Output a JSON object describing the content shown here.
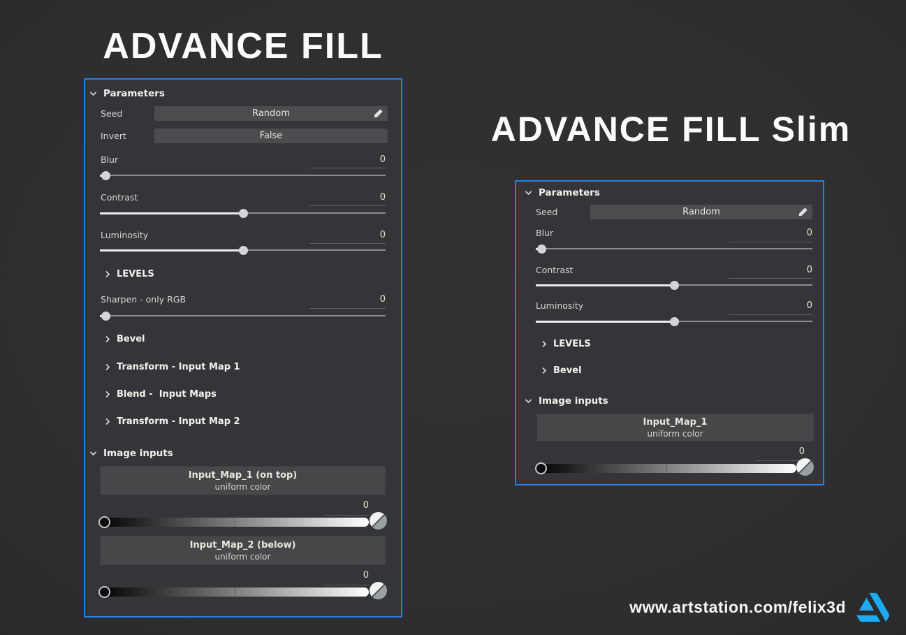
{
  "colors": {
    "accent_border": "#2b7de2",
    "artstation_blue": "#1caaf2",
    "panel_bg": "#333538",
    "button_bg": "#4a4c4e",
    "gradient_start": "#000000",
    "gradient_end": "#ffffff"
  },
  "left_panel": {
    "title": "ADVANCE FILL",
    "sections": {
      "parameters": "Parameters",
      "levels": "LEVELS",
      "bevel": "Bevel",
      "transform_1": "Transform - Input Map 1",
      "blend": "Blend -  Input Maps",
      "transform_2": "Transform - Input Map 2",
      "image_inputs": "Image inputs"
    },
    "seed": {
      "label": "Seed",
      "value": "Random"
    },
    "invert": {
      "label": "Invert",
      "value": "False"
    },
    "blur": {
      "label": "Blur",
      "value": "0",
      "handle_pct": 2
    },
    "contrast": {
      "label": "Contrast",
      "value": "0",
      "handle_pct": 50
    },
    "luminosity": {
      "label": "Luminosity",
      "value": "0",
      "handle_pct": 50
    },
    "sharpen": {
      "label": "Sharpen - only RGB",
      "value": "0",
      "handle_pct": 2
    },
    "input_map_1": {
      "title": "Input_Map_1 (on top)",
      "subtitle": "uniform color",
      "value": "0"
    },
    "input_map_2": {
      "title": "Input_Map_2 (below)",
      "subtitle": "uniform color",
      "value": "0"
    }
  },
  "right_panel": {
    "title": "ADVANCE FILL Slim",
    "sections": {
      "parameters": "Parameters",
      "levels": "LEVELS",
      "bevel": "Bevel",
      "image_inputs": "Image inputs"
    },
    "seed": {
      "label": "Seed",
      "value": "Random"
    },
    "blur": {
      "label": "Blur",
      "value": "0",
      "handle_pct": 2
    },
    "contrast": {
      "label": "Contrast",
      "value": "0",
      "handle_pct": 50
    },
    "luminosity": {
      "label": "Luminosity",
      "value": "0",
      "handle_pct": 50
    },
    "input_map_1": {
      "title": "Input_Map_1",
      "subtitle": "uniform color",
      "value": "0"
    }
  },
  "footer": {
    "url": "www.artstation.com/felix3d",
    "logo": "artstation-logo"
  }
}
